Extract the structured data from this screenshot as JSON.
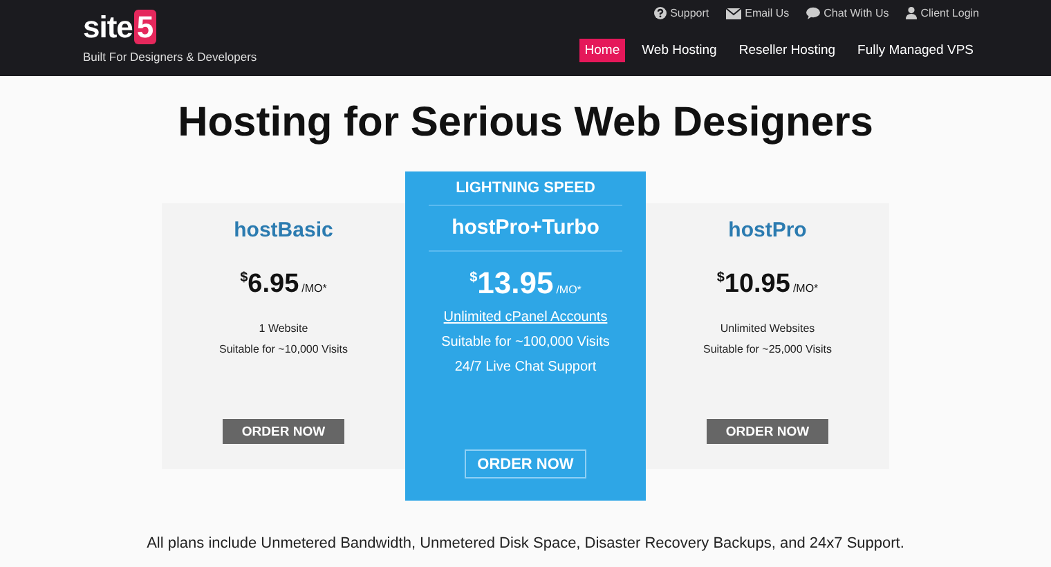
{
  "header": {
    "logo": {
      "text": "site",
      "badge": "5"
    },
    "tagline": "Built For Designers & Developers",
    "top_links": [
      {
        "kind": "support",
        "label": "Support"
      },
      {
        "kind": "email",
        "label": "Email Us"
      },
      {
        "kind": "chat",
        "label": "Chat With Us"
      },
      {
        "kind": "user",
        "label": "Client Login"
      }
    ],
    "nav": [
      {
        "label": "Home",
        "selected": true
      },
      {
        "label": "Web Hosting",
        "selected": false
      },
      {
        "label": "Reseller Hosting",
        "selected": false
      },
      {
        "label": "Fully Managed VPS",
        "selected": false
      }
    ]
  },
  "heading": "Hosting for Serious Web Designers",
  "plans": [
    {
      "featured": false,
      "name": "hostBasic",
      "currency": "$",
      "amount": "6.95",
      "unit": "/MO*",
      "features": [
        {
          "text": "1 Website",
          "link": false
        },
        {
          "text": "Suitable for ~10,000 Visits",
          "link": false
        }
      ],
      "button": "ORDER NOW"
    },
    {
      "featured": true,
      "badge": "LIGHTNING SPEED",
      "name": "hostPro+Turbo",
      "currency": "$",
      "amount": "13.95",
      "unit": "/MO*",
      "features": [
        {
          "text": "Unlimited cPanel Accounts",
          "link": true
        },
        {
          "text": "Suitable for ~100,000 Visits",
          "link": false
        },
        {
          "text": "24/7 Live Chat Support",
          "link": false
        }
      ],
      "button": "ORDER NOW"
    },
    {
      "featured": false,
      "name": "hostPro",
      "currency": "$",
      "amount": "10.95",
      "unit": "/MO*",
      "features": [
        {
          "text": "Unlimited Websites",
          "link": false
        },
        {
          "text": "Suitable for ~25,000 Visits",
          "link": false
        }
      ],
      "button": "ORDER NOW"
    }
  ],
  "footnote": "All plans include Unmetered Bandwidth, Unmetered Disk Space, Disaster Recovery Backups, and 24x7 Support."
}
